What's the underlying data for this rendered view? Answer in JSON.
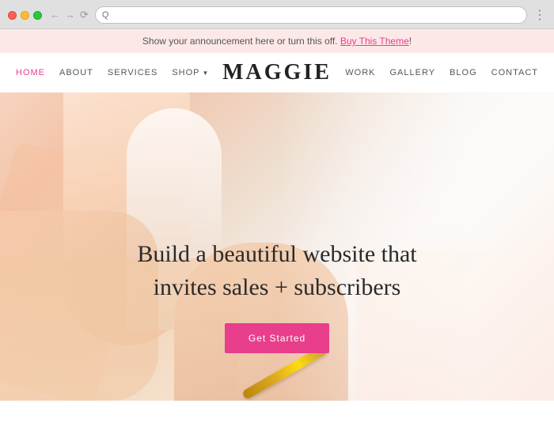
{
  "browser": {
    "dots": [
      "red",
      "yellow",
      "green"
    ],
    "address_placeholder": "Q",
    "address_value": ""
  },
  "announcement": {
    "text": "Show your announcement here or turn this off. ",
    "link_text": "Buy This Theme",
    "link_url": "#"
  },
  "nav": {
    "logo": "MAGGIE",
    "links_left": [
      {
        "label": "HOME",
        "active": true
      },
      {
        "label": "ABOUT",
        "active": false
      },
      {
        "label": "SERVICES",
        "active": false
      },
      {
        "label": "SHOP",
        "active": false,
        "has_dropdown": true
      }
    ],
    "links_right": [
      {
        "label": "WORK",
        "active": false
      },
      {
        "label": "GALLERY",
        "active": false
      },
      {
        "label": "BLOG",
        "active": false
      },
      {
        "label": "CONTACT",
        "active": false
      }
    ]
  },
  "hero": {
    "title_line1": "Build a beautiful website that",
    "title_line2": "invites sales + subscribers",
    "cta_label": "Get Started"
  },
  "colors": {
    "accent": "#e83e8c",
    "announcement_bg": "#fde8e8",
    "nav_active": "#e83e8c"
  }
}
